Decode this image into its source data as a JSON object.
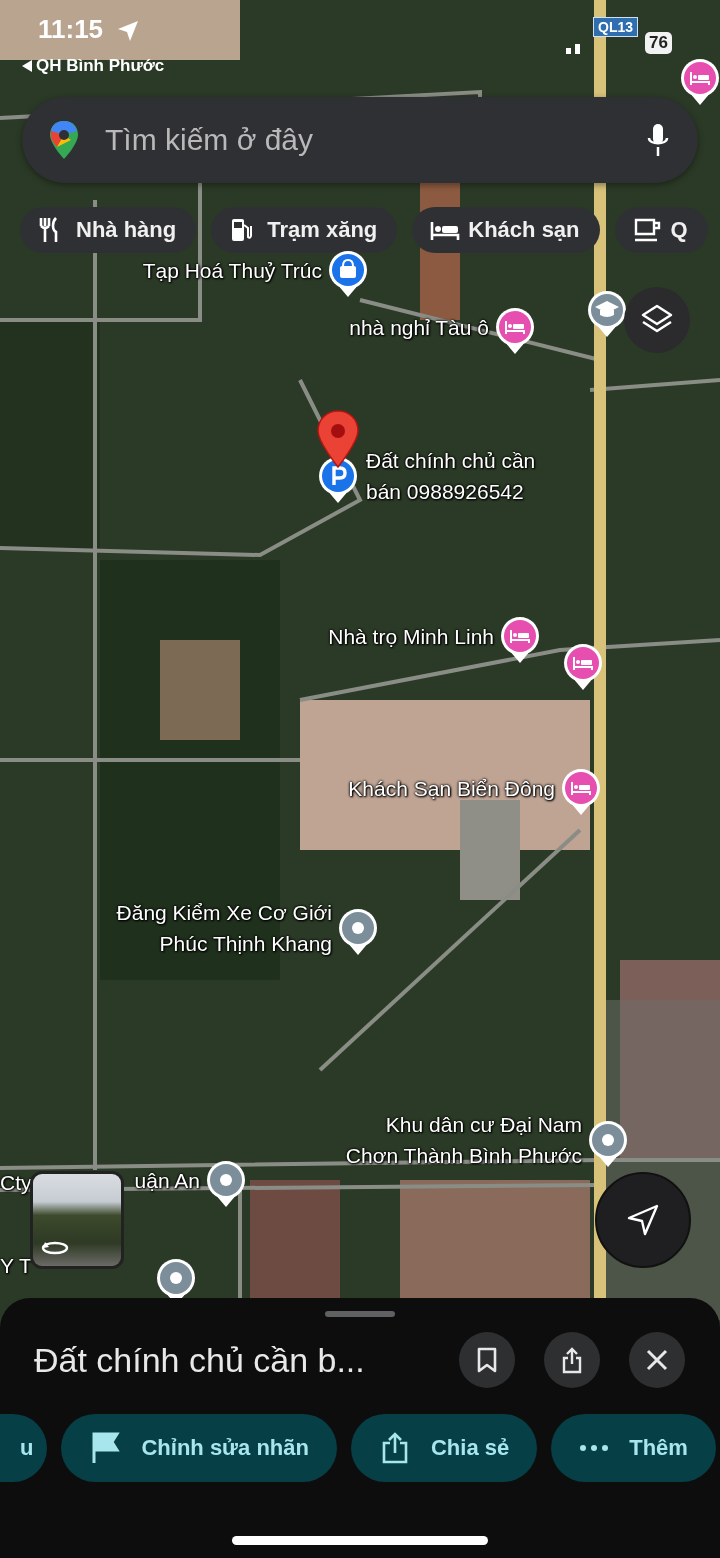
{
  "status_bar": {
    "time": "11:15",
    "back_link": "QH Bình Phước",
    "battery": "76"
  },
  "search": {
    "placeholder": "Tìm kiếm ở đây"
  },
  "categories": [
    {
      "label": "Nhà hàng",
      "kind": "restaurant"
    },
    {
      "label": "Trạm xăng",
      "kind": "gas"
    },
    {
      "label": "Khách sạn",
      "kind": "hotel"
    },
    {
      "label": "Q",
      "kind": "cafe"
    }
  ],
  "map": {
    "road_shield": "QL13",
    "places": [
      {
        "label": "Tạp Hoá Thuỷ Trúc",
        "kind": "shop"
      },
      {
        "label": "nhà nghỉ Tàu ô",
        "kind": "hotel"
      },
      {
        "kind": "school"
      },
      {
        "kind": "hotel"
      },
      {
        "label": "Đất chính chủ cần\nbán 0988926542",
        "kind": "parking",
        "selected": true
      },
      {
        "label": "Nhà trọ Minh Linh",
        "kind": "hotel"
      },
      {
        "kind": "hotel"
      },
      {
        "label": "Khách Sạn Biển Đông",
        "kind": "hotel"
      },
      {
        "label": "Đăng Kiểm Xe Cơ Giới\nPhúc Thịnh Khang",
        "kind": "place"
      },
      {
        "label": "Khu dân cư Đại Nam\nChơn Thành Bình Phước",
        "kind": "place"
      },
      {
        "label": "uận An",
        "kind": "place"
      },
      {
        "kind": "place"
      }
    ],
    "label_fragments": [
      "Cty",
      "Y T"
    ]
  },
  "place_sheet": {
    "title": "Đất chính chủ cần b...",
    "actions": [
      {
        "label": "u",
        "kind": "save"
      },
      {
        "label": "Chỉnh sửa nhãn",
        "kind": "label"
      },
      {
        "label": "Chia sẻ",
        "kind": "share"
      },
      {
        "label": "Thêm",
        "kind": "more"
      }
    ]
  }
}
